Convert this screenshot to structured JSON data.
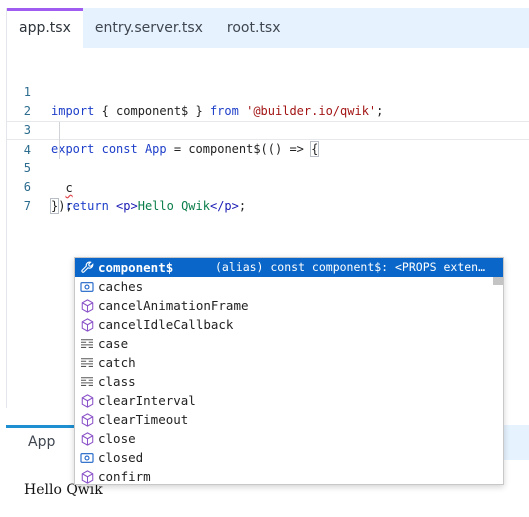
{
  "editor": {
    "tabs": [
      {
        "label": "app.tsx",
        "active": true
      },
      {
        "label": "entry.server.tsx",
        "active": false
      },
      {
        "label": "root.tsx",
        "active": false
      }
    ],
    "lines": [
      {
        "num": "1",
        "text": "import { component$ } from '@builder.io/qwik';"
      },
      {
        "num": "2",
        "text": ""
      },
      {
        "num": "3",
        "text": "export const App = component$(() => {"
      },
      {
        "num": "4",
        "text": "  c"
      },
      {
        "num": "5",
        "text": "  return <p>Hello Qwik</p>;"
      },
      {
        "num": "6",
        "text": "});"
      },
      {
        "num": "7",
        "text": ""
      }
    ],
    "tokens": {
      "l1_kw1": "import",
      "l1_mid": " { component$ } ",
      "l1_kw2": "from",
      "l1_sp": " ",
      "l1_str": "'@builder.io/qwik'",
      "l1_end": ";",
      "l3_kw1": "export",
      "l3_kw2": "const",
      "l3_name": "App",
      "l3_rest": " = component$(() => ",
      "l3_brace": "{",
      "l4_typed": "c",
      "l5_kw": "return",
      "l5_tag_open": "<p>",
      "l5_text": "Hello Qwik",
      "l5_tag_close": "</p>",
      "l5_end": ";",
      "l6_brace": "}",
      "l6_end": ");"
    }
  },
  "suggestions": {
    "items": [
      {
        "icon": "wrench-icon",
        "label": "component$",
        "detail": "(alias) const component$: <PROPS extends …",
        "selected": true
      },
      {
        "icon": "variable-icon",
        "label": "caches"
      },
      {
        "icon": "cube-icon",
        "label": "cancelAnimationFrame"
      },
      {
        "icon": "cube-icon",
        "label": "cancelIdleCallback"
      },
      {
        "icon": "snippet-icon",
        "label": "case"
      },
      {
        "icon": "snippet-icon",
        "label": "catch"
      },
      {
        "icon": "snippet-icon",
        "label": "class"
      },
      {
        "icon": "cube-icon",
        "label": "clearInterval"
      },
      {
        "icon": "cube-icon",
        "label": "clearTimeout"
      },
      {
        "icon": "cube-icon",
        "label": "close"
      },
      {
        "icon": "variable-icon",
        "label": "closed"
      },
      {
        "icon": "cube-icon",
        "label": "confirm"
      }
    ],
    "colors": {
      "selected_bg": "#0a66c8",
      "icon": "#8a52c8",
      "variable_icon": "#1d63c8"
    }
  },
  "preview": {
    "tab_label": "App",
    "content": "Hello Qwik"
  }
}
